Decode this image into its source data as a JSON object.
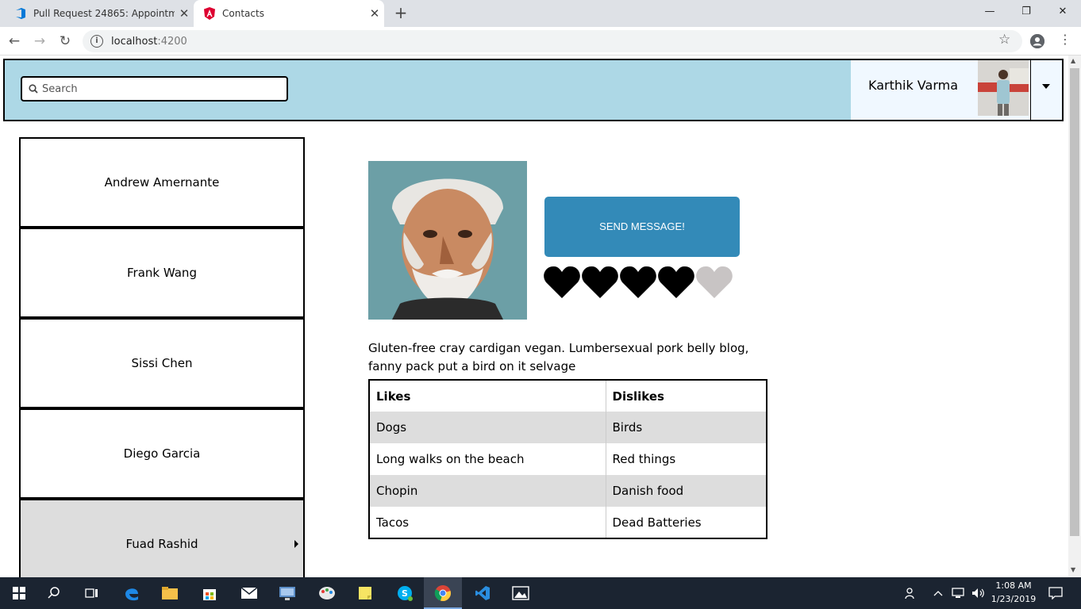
{
  "browser": {
    "tabs": [
      {
        "title": "Pull Request 24865: Appointment",
        "icon": "azure-devops-icon",
        "active": false
      },
      {
        "title": "Contacts",
        "icon": "angular-icon",
        "active": true
      }
    ],
    "new_tab": "+",
    "window_controls": {
      "minimize": "—",
      "restore": "❐",
      "close": "✕"
    },
    "address": {
      "host": "localhost",
      "port": ":4200"
    },
    "nav": {
      "back": "←",
      "forward": "→",
      "reload": "↻"
    }
  },
  "header": {
    "search_placeholder": "Search",
    "user_name": "Karthik Varma"
  },
  "contacts": [
    {
      "name": "Andrew Amernante",
      "selected": false
    },
    {
      "name": "Frank Wang",
      "selected": false
    },
    {
      "name": "Sissi Chen",
      "selected": false
    },
    {
      "name": "Diego Garcia",
      "selected": false
    },
    {
      "name": "Fuad Rashid",
      "selected": true
    }
  ],
  "detail": {
    "send_button": "SEND MESSAGE!",
    "rating": 4,
    "rating_max": 5,
    "bio": "Gluten-free cray cardigan vegan. Lumbersexual pork belly blog, fanny pack put a bird on it selvage",
    "table": {
      "headers": [
        "Likes",
        "Dislikes"
      ],
      "rows": [
        [
          "Dogs",
          "Birds"
        ],
        [
          "Long walks on the beach",
          "Red things"
        ],
        [
          "Chopin",
          "Danish food"
        ],
        [
          "Tacos",
          "Dead Batteries"
        ]
      ]
    }
  },
  "taskbar": {
    "clock_time": "1:08 AM",
    "clock_date": "1/23/2019"
  },
  "colors": {
    "header_bg": "#add8e6",
    "send_button": "#338ab8",
    "heart_filled": "#000000",
    "heart_empty": "#c8c4c4",
    "selected_contact": "#dddddd"
  }
}
